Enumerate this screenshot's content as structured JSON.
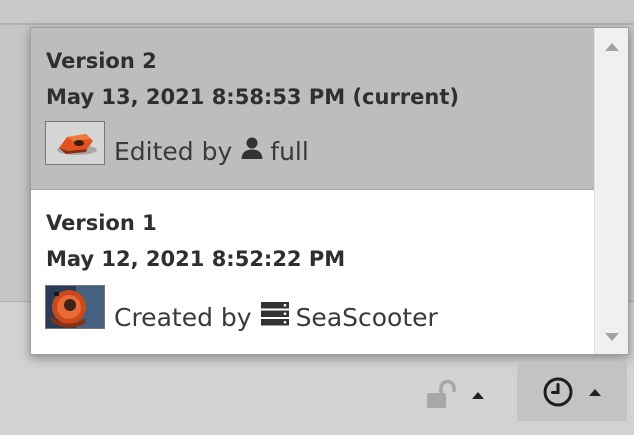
{
  "versions": [
    {
      "title": "Version 2",
      "date": "May 13, 2021 8:58:53 PM (current)",
      "byline_prefix": "Edited by",
      "user_icon": "user-icon",
      "user": "full",
      "current": true
    },
    {
      "title": "Version 1",
      "date": "May 12, 2021 8:52:22 PM",
      "byline_prefix": "Created by",
      "user_icon": "server-icon",
      "user": "SeaScooter",
      "current": false
    }
  ],
  "toolbar": {
    "lock_icon": "unlock-icon",
    "history_icon": "clock-icon",
    "dropdown_icon": "caret-up-icon"
  },
  "colors": {
    "current_row_bg": "#bdbdbd",
    "popup_bg": "#ffffff",
    "page_bg": "#cfcfcf"
  }
}
